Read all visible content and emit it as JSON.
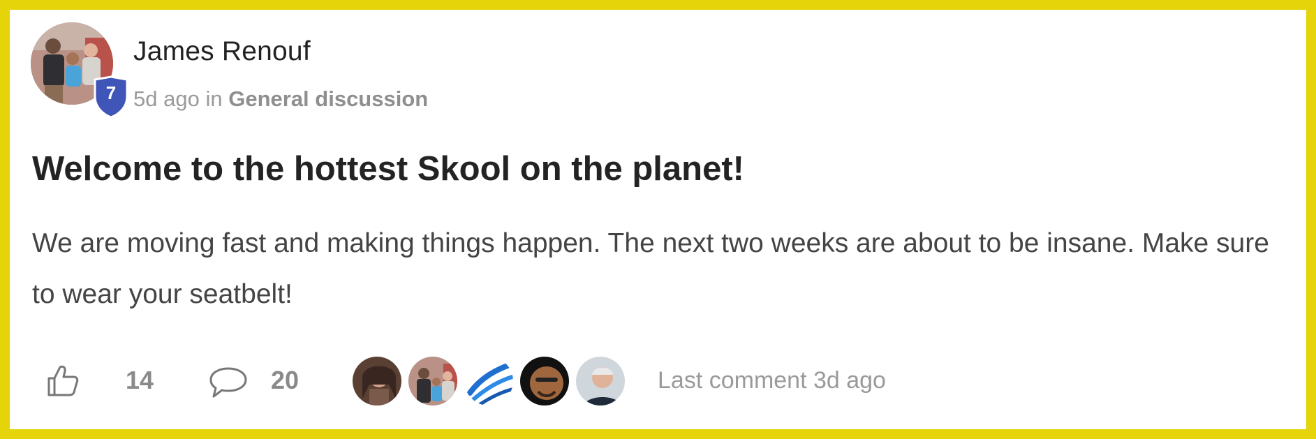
{
  "post": {
    "author": {
      "name": "James Renouf",
      "level": "7"
    },
    "meta": {
      "time": "5d ago",
      "in_word": "in",
      "category": "General discussion"
    },
    "title": "Welcome to the hottest Skool on the planet!",
    "body": "We are moving fast and making things happen. The next two weeks are about to be insane. Make sure to wear your seatbelt!",
    "likes": "14",
    "comments": "20",
    "last_comment": "Last comment 3d ago"
  },
  "colors": {
    "frame": "#e5d40a",
    "badge": "#3f55b8"
  },
  "icons": [
    "like-icon",
    "comment-icon",
    "level-shield-icon"
  ]
}
